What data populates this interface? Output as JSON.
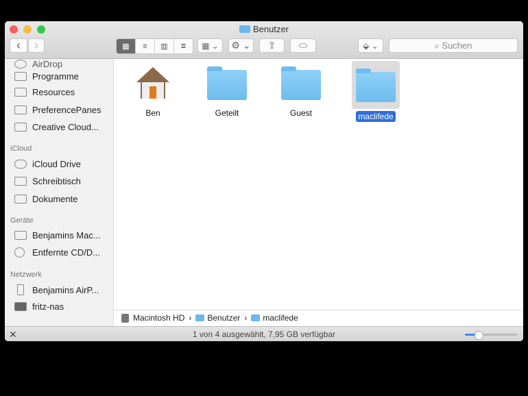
{
  "window": {
    "title": "Benutzer"
  },
  "toolbar": {
    "back": "‹",
    "forward": "›",
    "view_icon": "▦",
    "view_list": "≡",
    "view_column": "▥",
    "view_cover": "⧈",
    "arrange": "▦ ⌄",
    "action": "⚙ ⌄",
    "share": "⇪",
    "tag": "⬭",
    "dropbox": "⬙ ⌄",
    "search_placeholder": "Suchen"
  },
  "sidebar": {
    "items_top": [
      "AirDrop",
      "Programme",
      "Resources",
      "PreferencePanes",
      "Creative Cloud..."
    ],
    "icloud_header": "iCloud",
    "icloud": [
      "iCloud Drive",
      "Schreibtisch",
      "Dokumente"
    ],
    "devices_header": "Geräte",
    "devices": [
      "Benjamins Mac...",
      "Entfernte CD/D..."
    ],
    "network_header": "Netzwerk",
    "network": [
      "Benjamins AirP...",
      "fritz-nas"
    ]
  },
  "files": [
    {
      "name": "Ben"
    },
    {
      "name": "Geteilt"
    },
    {
      "name": "Guest"
    },
    {
      "name": "maclifede",
      "selected": true
    }
  ],
  "path": [
    "Macintosh HD",
    "Benutzer",
    "maclifede"
  ],
  "status": {
    "text": "1 von 4 ausgewählt, 7,95 GB verfügbar",
    "icon_size": 0.25
  },
  "colors": {
    "selection": "#2f6fd6",
    "folder": "#6dbdee"
  }
}
